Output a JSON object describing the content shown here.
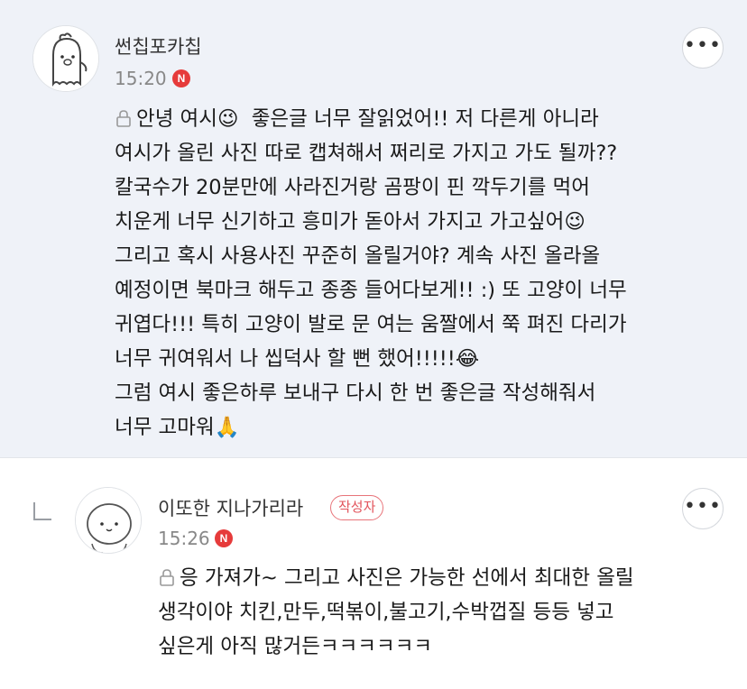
{
  "comments": [
    {
      "author": "썬칩포카칩",
      "time": "15:20",
      "new_badge": "N",
      "more_label": "•••",
      "text": "안녕 여시😉  좋은글 너무 잘읽었어!! 저 다른게 아니라\n여시가 올린 사진 따로 캡쳐해서 쩌리로 가지고 가도 될까??\n칼국수가 20분만에 사라진거랑 곰팡이 핀 깍두기를 먹어\n치운게 너무 신기하고 흥미가 돋아서 가지고 가고싶어😉\n그리고 혹시 사용사진 꾸준히 올릴거야? 계속 사진 올라올\n예정이면 북마크 해두고 종종 들어다보게!! :) 또 고양이 너무\n귀엽다!!! 특히 고양이 발로 문 여는 움짤에서 쭉 펴진 다리가\n너무 귀여워서 나 씹덕사 할 뻔 했어!!!!!😂\n그럼 여시 좋은하루 보내구 다시 한 번 좋은글 작성해줘서\n너무 고마워🙏"
    },
    {
      "author": "이또한 지나가리라",
      "writer_badge": "작성자",
      "time": "15:26",
      "new_badge": "N",
      "more_label": "•••",
      "text": "응 가져가~ 그리고 사진은 가능한 선에서 최대한 올릴\n생각이야 치킨,만두,떡볶이,불고기,수박껍질 등등 넣고\n싶은게 아직 많거든ㅋㅋㅋㅋㅋㅋ"
    }
  ],
  "icons": {
    "lock": "lock-icon",
    "reply": "reply-arrow-icon",
    "more": "more-options-icon",
    "avatar1": "ghost-character-avatar",
    "avatar2": "round-face-avatar"
  }
}
